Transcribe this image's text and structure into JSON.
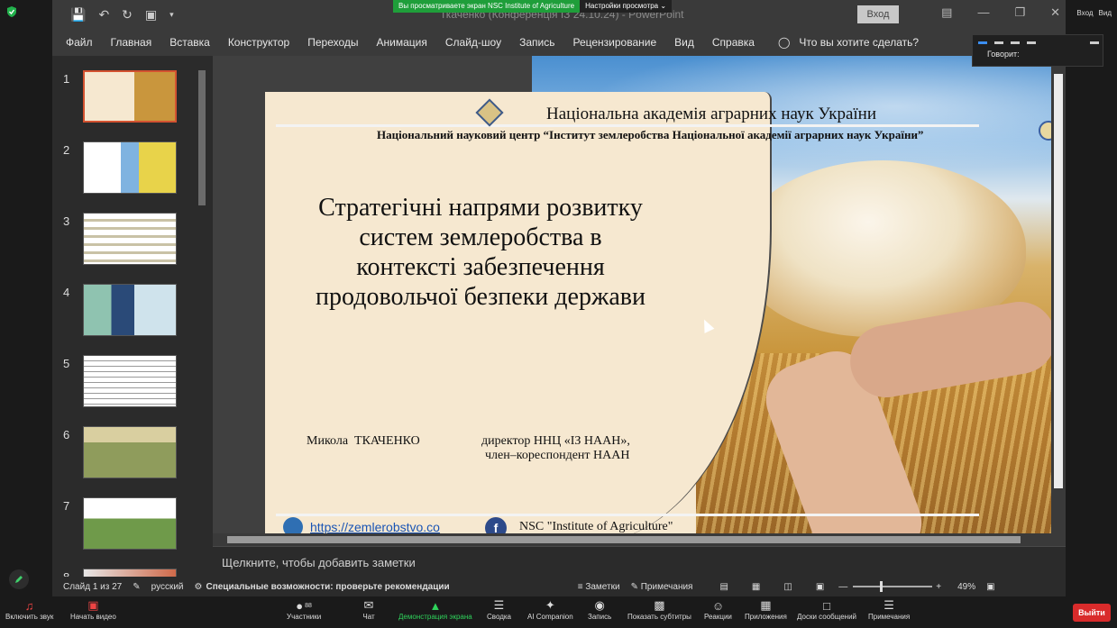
{
  "zoom": {
    "share_banner": "Вы просматриваете экран NSC Institute of Agriculture",
    "view_options": "Настройки просмотра",
    "top_right_login": "Вход",
    "top_right_view": "Вид",
    "speaking_label": "Говорит:",
    "toolbar": [
      {
        "label": "Включить звук",
        "icon": "mic-muted-icon"
      },
      {
        "label": "Начать видео",
        "icon": "video-off-icon"
      },
      {
        "label": "Участники",
        "icon": "participants-icon",
        "count": "88"
      },
      {
        "label": "Чат",
        "icon": "chat-icon"
      },
      {
        "label": "Демонстрация экрана",
        "icon": "share-screen-icon"
      },
      {
        "label": "Сводка",
        "icon": "summary-icon"
      },
      {
        "label": "AI Companion",
        "icon": "ai-companion-icon"
      },
      {
        "label": "Запись",
        "icon": "record-icon"
      },
      {
        "label": "Показать субтитры",
        "icon": "captions-icon"
      },
      {
        "label": "Реакции",
        "icon": "reactions-icon"
      },
      {
        "label": "Приложения",
        "icon": "apps-icon"
      },
      {
        "label": "Доски сообщений",
        "icon": "whiteboards-icon"
      },
      {
        "label": "Примечания",
        "icon": "notes-icon"
      }
    ],
    "leave_label": "Выйти"
  },
  "ppt": {
    "window_title": "Ткаченко (Конференція ІЗ 24.10.24)  -  PowerPoint",
    "login_button": "Вход",
    "menu": [
      "Файл",
      "Главная",
      "Вставка",
      "Конструктор",
      "Переходы",
      "Анимация",
      "Слайд-шоу",
      "Запись",
      "Рецензирование",
      "Вид",
      "Справка"
    ],
    "tell_me": "Что вы хотите сделать?",
    "thumbnails": [
      "1",
      "2",
      "3",
      "4",
      "5",
      "6",
      "7",
      "8"
    ],
    "notes_placeholder": "Щелкните, чтобы добавить заметки",
    "status": {
      "slide_counter": "Слайд 1 из 27",
      "language": "русский",
      "accessibility": "Специальные возможности: проверьте рекомендации",
      "notes": "Заметки",
      "comments": "Примечания",
      "zoom_level": "49%"
    }
  },
  "slide": {
    "academy": "Національна академія аграрних наук України",
    "center": "Національний науковий центр “Інститут землеробства Національної академії аграрних наук України”",
    "slide_number": "1",
    "title_lines": [
      "Стратегічні напрями розвитку",
      "систем землеробства в",
      "контексті забезпечення",
      "продовольчої безпеки держави"
    ],
    "author": "Микола  ТКАЧЕНКО",
    "position_line1": "директор ННЦ «ІЗ НААН»,",
    "position_line2": "член–кореспондент НААН",
    "website": "https://zemlerobstvo.co",
    "facebook": "NSC \"Institute of Agriculture\""
  }
}
